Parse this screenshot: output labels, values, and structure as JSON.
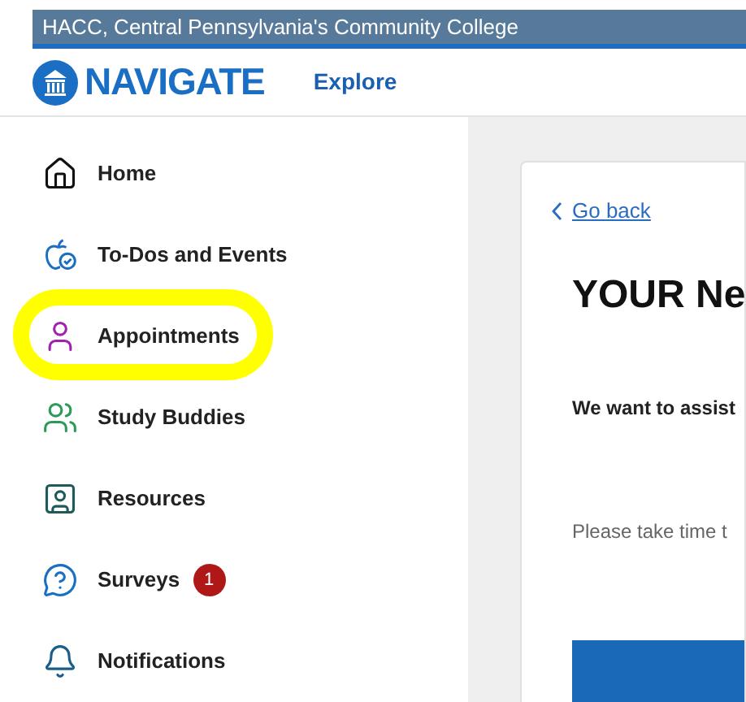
{
  "banner": {
    "title": "HACC, Central Pennsylvania's Community College"
  },
  "header": {
    "logo_text": "NAVIGATE",
    "nav_link": "Explore"
  },
  "sidebar": {
    "items": [
      {
        "kind": "home",
        "label": "Home",
        "highlighted": false
      },
      {
        "kind": "todos",
        "label": "To-Dos and Events",
        "highlighted": false
      },
      {
        "kind": "appointments",
        "label": "Appointments",
        "highlighted": true
      },
      {
        "kind": "buddies",
        "label": "Study Buddies",
        "highlighted": false
      },
      {
        "kind": "resources",
        "label": "Resources",
        "highlighted": false
      },
      {
        "kind": "surveys",
        "label": "Surveys",
        "badge": "1",
        "highlighted": false
      },
      {
        "kind": "notifications",
        "label": "Notifications",
        "highlighted": false
      }
    ]
  },
  "card": {
    "back_link": "Go back",
    "title": "YOUR Ne",
    "intro": "We want to assist",
    "body": "Please take time t"
  }
}
